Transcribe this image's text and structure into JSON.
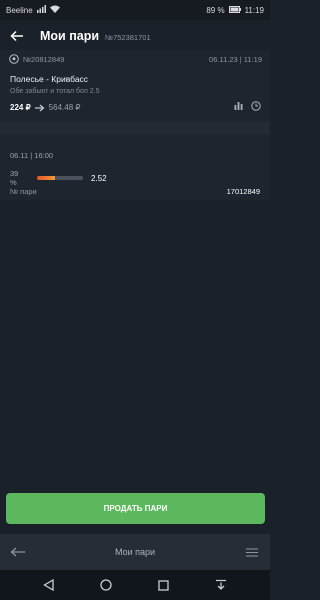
{
  "status_bar": {
    "carrier": "Beeline",
    "battery": "89 %",
    "time": "11:19"
  },
  "header": {
    "title": "Мои пари",
    "bet_number": "№752381701"
  },
  "bet": {
    "coupon_id": "№20812849",
    "date": "06.11.23 | 11:19",
    "match": "Полесье - Кривбасс",
    "description": "Обе забьют и тотал бол 2.5",
    "stake": "224 ₽",
    "payout": "564.48 ₽"
  },
  "details": {
    "event_date": "06.11 | 16:00",
    "probability_label": "39 %",
    "probability": 0.39,
    "odds": "2.52",
    "id_label": "№ пари",
    "id_value": "17012849"
  },
  "sell_button": {
    "label": "ПРОДАТЬ ПАРИ",
    "color": "#5cb85c"
  },
  "bottom_nav": {
    "title": "Мои пари"
  },
  "colors": {
    "accent_bar_start": "#e8522a",
    "accent_bar_end": "#f29a3a"
  }
}
